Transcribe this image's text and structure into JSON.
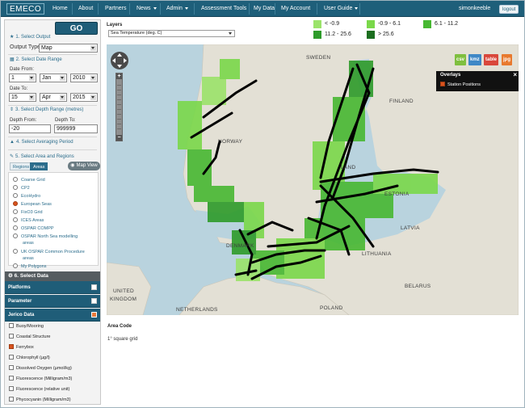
{
  "app": {
    "logo_text": "EMECO"
  },
  "nav": {
    "items": [
      {
        "label": "Home",
        "caret": false
      },
      {
        "label": "About",
        "caret": false
      },
      {
        "label": "Partners",
        "caret": false
      },
      {
        "label": "News",
        "caret": true
      },
      {
        "label": "Admin",
        "caret": true
      },
      {
        "label": "Assessment Tools",
        "caret": false
      },
      {
        "label": "My Data",
        "caret": false
      },
      {
        "label": "My Account",
        "caret": false
      },
      {
        "label": "User Guide",
        "caret": true
      }
    ],
    "username": "simonkeeble",
    "logout_label": "logout"
  },
  "left": {
    "go_label": "GO",
    "s1": "1. Select Output",
    "output_type_label": "Output Type:",
    "output_type_value": "Map",
    "s2": "2. Select Date Range",
    "date_from_label": "Date From:",
    "date_from": {
      "day": "1",
      "month": "Jan",
      "year": "2010"
    },
    "date_to_label": "Date To:",
    "date_to": {
      "day": "15",
      "month": "Apr",
      "year": "2015"
    },
    "s3": "3. Select Depth Range (metres)",
    "depth_from_label": "Depth From:",
    "depth_from": "-20",
    "depth_to_label": "Depth To:",
    "depth_to": "999999",
    "s4": "4. Select Averaging Period",
    "s5": "5. Select Area and Regions",
    "tabs": [
      "Regions",
      "Areas"
    ],
    "map_view_label": "Map View",
    "areas": [
      {
        "label": "Coarse Grid",
        "selected": false
      },
      {
        "label": "CP2",
        "selected": false
      },
      {
        "label": "EcoHydro",
        "selected": false
      },
      {
        "label": "European Seas",
        "selected": true
      },
      {
        "label": "FixO3 Grid",
        "selected": false
      },
      {
        "label": "ICES Areas",
        "selected": false
      },
      {
        "label": "OSPAR COMPP",
        "selected": false
      },
      {
        "label": "OSPAR North Sea modelling",
        "selected": false
      },
      {
        "label": "areas",
        "selected": null
      },
      {
        "label": "UK OSPAR Common Procedure",
        "selected": false
      },
      {
        "label": "areas",
        "selected": null
      },
      {
        "label": "My Polygons",
        "selected": false
      }
    ],
    "s6": "6. Select Data",
    "data_sections": [
      {
        "label": "Platforms",
        "checked": false
      },
      {
        "label": "Parameter",
        "checked": false
      },
      {
        "label": "Jerico Data",
        "checked": true
      }
    ],
    "jerico_items": [
      {
        "label": "Buoy/Mooring",
        "checked": false
      },
      {
        "label": "Coastal Structure",
        "checked": false
      },
      {
        "label": "Ferrybox",
        "checked": true
      },
      {
        "label": "Chlorophyll (µg/l)",
        "checked": false
      },
      {
        "label": "Dissolved Oxygen (µmol/kg)",
        "checked": false
      },
      {
        "label": "Fluorescence (Milligram/m3)",
        "checked": false
      },
      {
        "label": "Fluorescence (relative unit)",
        "checked": false
      },
      {
        "label": "Phycocyanin (Milligram/m3)",
        "checked": false
      }
    ]
  },
  "layers": {
    "title": "Layers",
    "selected": "Sea Temperature (deg. C)",
    "legend": [
      {
        "label": "< -0.9",
        "color": "#9be36a"
      },
      {
        "label": "-0.9 - 6.1",
        "color": "#7ad84a"
      },
      {
        "label": "6.1 - 11.2",
        "color": "#47b832"
      },
      {
        "label": "11.2 - 25.6",
        "color": "#2e9b2a"
      },
      {
        "label": "> 25.6",
        "color": "#1b6e1f"
      }
    ]
  },
  "map": {
    "countries": [
      {
        "name": "SWEDEN"
      },
      {
        "name": "FINLAND"
      },
      {
        "name": "NORWAY"
      },
      {
        "name": "ESTONIA"
      },
      {
        "name": "LATVIA"
      },
      {
        "name": "DENMARK"
      },
      {
        "name": "LITHUANIA"
      },
      {
        "name": "UNITED"
      },
      {
        "name": "KINGDOM"
      },
      {
        "name": "BELARUS"
      },
      {
        "name": "NETHERLANDS"
      },
      {
        "name": "POLAND"
      },
      {
        "name": "LAND"
      }
    ],
    "export_buttons": [
      {
        "label": "csv",
        "color": "#7fbf3f"
      },
      {
        "label": "kmz",
        "color": "#3f88c6"
      },
      {
        "label": "table",
        "color": "#d9473b"
      },
      {
        "label": "jpg",
        "color": "#e8792e"
      }
    ],
    "overlays_title": "Overlays",
    "overlays_item": "Station Positions",
    "overlays_checked": true
  },
  "area_code": {
    "title": "Area Code",
    "value": "1° square grid"
  }
}
